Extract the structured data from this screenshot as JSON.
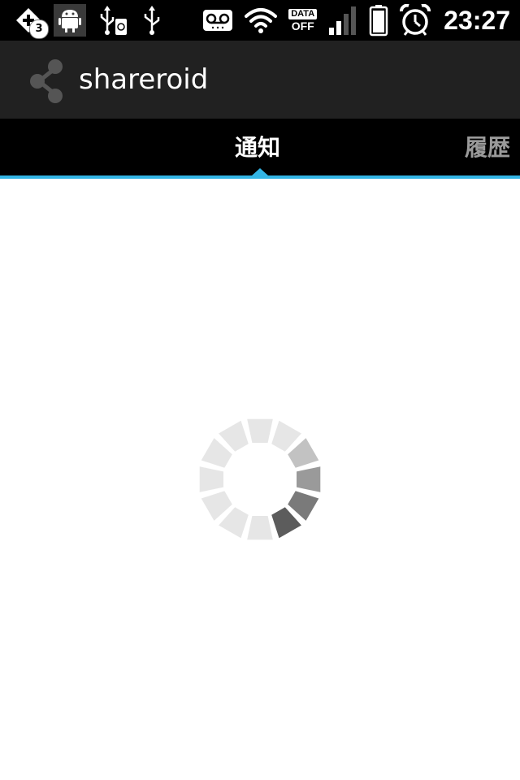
{
  "status_bar": {
    "notification_badge": "3",
    "data_label": "DATA",
    "data_state": "OFF",
    "time": "23:27",
    "icons": [
      "plus-notification-icon",
      "android-debug-icon",
      "usb-storage-icon",
      "usb-icon",
      "voicemail-icon",
      "wifi-icon",
      "data-off-icon",
      "signal-icon",
      "battery-icon",
      "alarm-icon"
    ]
  },
  "action_bar": {
    "app_icon": "share-icon",
    "title": "shareroid"
  },
  "tabs": [
    {
      "label": "通知",
      "selected": true
    },
    {
      "label": "履歴",
      "selected": false
    }
  ],
  "content": {
    "loading": "spinner-icon"
  },
  "colors": {
    "accent": "#33b5e5",
    "action_bar_bg": "#212121",
    "tab_strip_bg": "#000000",
    "inactive_tab_text": "#9a9a9a"
  }
}
